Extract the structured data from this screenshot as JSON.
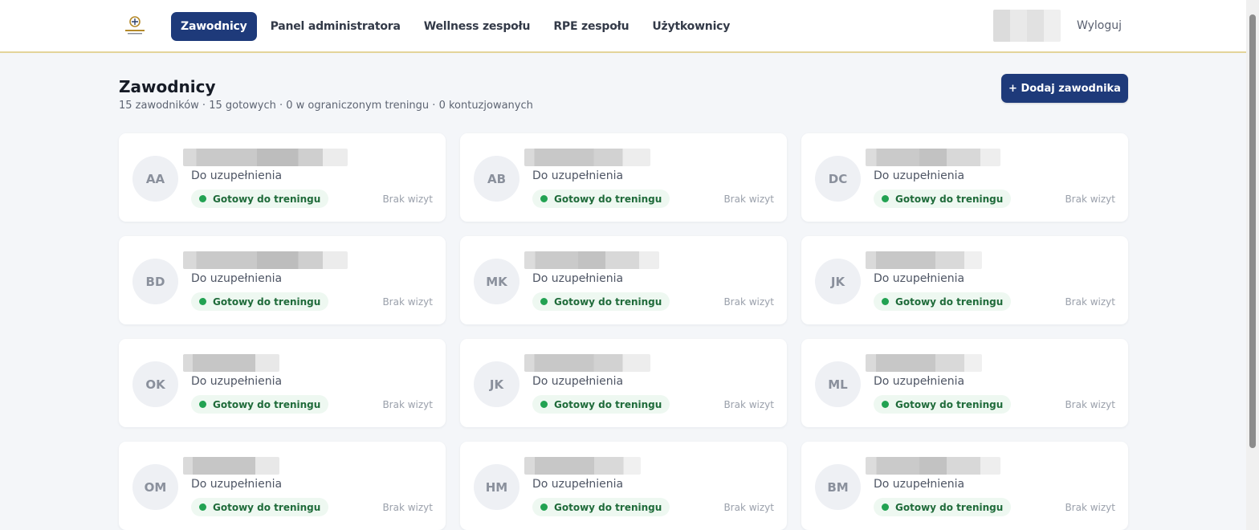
{
  "header": {
    "logo_icon": "team-logo-icon",
    "nav": [
      {
        "label": "Zawodnicy",
        "active": true
      },
      {
        "label": "Panel administratora",
        "active": false
      },
      {
        "label": "Wellness zespołu",
        "active": false
      },
      {
        "label": "RPE zespołu",
        "active": false
      },
      {
        "label": "Użytkownicy",
        "active": false
      }
    ],
    "logout_label": "Wyloguj"
  },
  "page": {
    "title": "Zawodnicy",
    "subtitle": "15 zawodników · 15 gotowych · 0 w ograniczonym treningu · 0 kontuzjowanych",
    "add_button_label": "+ Dodaj zawodnika"
  },
  "players": [
    {
      "initials": "AA",
      "position": "Do uzupełnienia",
      "status": "Gotowy do treningu",
      "visits": "Brak wizyt"
    },
    {
      "initials": "AB",
      "position": "Do uzupełnienia",
      "status": "Gotowy do treningu",
      "visits": "Brak wizyt"
    },
    {
      "initials": "DC",
      "position": "Do uzupełnienia",
      "status": "Gotowy do treningu",
      "visits": "Brak wizyt"
    },
    {
      "initials": "BD",
      "position": "Do uzupełnienia",
      "status": "Gotowy do treningu",
      "visits": "Brak wizyt"
    },
    {
      "initials": "MK",
      "position": "Do uzupełnienia",
      "status": "Gotowy do treningu",
      "visits": "Brak wizyt"
    },
    {
      "initials": "JK",
      "position": "Do uzupełnienia",
      "status": "Gotowy do treningu",
      "visits": "Brak wizyt"
    },
    {
      "initials": "OK",
      "position": "Do uzupełnienia",
      "status": "Gotowy do treningu",
      "visits": "Brak wizyt"
    },
    {
      "initials": "JK",
      "position": "Do uzupełnienia",
      "status": "Gotowy do treningu",
      "visits": "Brak wizyt"
    },
    {
      "initials": "ML",
      "position": "Do uzupełnienia",
      "status": "Gotowy do treningu",
      "visits": "Brak wizyt"
    },
    {
      "initials": "OM",
      "position": "Do uzupełnienia",
      "status": "Gotowy do treningu",
      "visits": "Brak wizyt"
    },
    {
      "initials": "HM",
      "position": "Do uzupełnienia",
      "status": "Gotowy do treningu",
      "visits": "Brak wizyt"
    },
    {
      "initials": "BM",
      "position": "Do uzupełnienia",
      "status": "Gotowy do treningu",
      "visits": "Brak wizyt"
    }
  ],
  "colors": {
    "primary": "#1e3a7a",
    "status_green": "#22a252",
    "header_border": "#e3d49a"
  }
}
